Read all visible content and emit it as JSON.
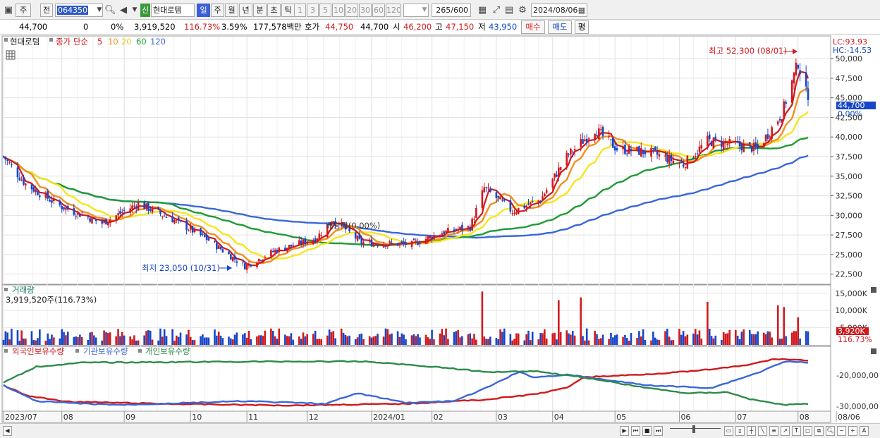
{
  "toolbar": {
    "type_label": "주",
    "prev_label": "전",
    "stock_code": "064350",
    "new_badge": "신",
    "stock_name": "현대로템",
    "periods": [
      "일",
      "주",
      "월",
      "년",
      "분",
      "초",
      "틱"
    ],
    "active_period": "일",
    "intervals": [
      "1",
      "3",
      "5",
      "10",
      "20",
      "30",
      "60",
      "120"
    ],
    "count_value": "265",
    "count_total": "/600",
    "date_value": "2024/08/06"
  },
  "info": {
    "price": "44,700",
    "change": "0",
    "change_pct": "0%",
    "volume": "3,919,520",
    "volume_ratio": "116.73%",
    "turnover": "3.59%",
    "amount": "177,578백만",
    "ask_label": "호가",
    "ask_value": "44,750",
    "bid_value": "44,700",
    "open_label": "시",
    "open_value": "46,200",
    "high_label": "고",
    "high_value": "47,150",
    "low_label": "저",
    "low_value": "43,950",
    "buy_label": "매수",
    "sell_label": "매도",
    "avg_label": "평"
  },
  "price_panel": {
    "stock_label": "현대로템",
    "ma_label": "종가 단순",
    "ma_periods": [
      "5",
      "10",
      "20",
      "60",
      "120"
    ],
    "lc_label": "LC:93.93",
    "hc_label": "HC:-14.53",
    "max_label": "최고 52,300 (08/01)",
    "min_label": "최저 23,050 (10/31)",
    "dividend_label": "배당락(0.00%)",
    "current_price_tag": "44,700",
    "current_pct_tag": "0.00%",
    "y_ticks": [
      "50,000",
      "47,500",
      "45,000",
      "42,500",
      "40,000",
      "37,500",
      "35,000",
      "32,500",
      "30,000",
      "27,500",
      "25,000",
      "22,500"
    ]
  },
  "volume_panel": {
    "title": "거래량",
    "value_label": "3,919,520주(116.73%)",
    "y_ticks": [
      "15,000K",
      "10,000K",
      "5,000K"
    ],
    "current_tag": "3,920K",
    "current_pct": "116.73%"
  },
  "holding_panel": {
    "legend": [
      "외국인보유수량",
      "기관보유수량",
      "개인보유수량"
    ],
    "y_ticks": [
      "-20,000,00",
      "-30,000,00"
    ]
  },
  "x_labels": [
    "2023/07",
    "08",
    "09",
    "10",
    "11",
    "12",
    "2024/01",
    "02",
    "03",
    "04",
    "05",
    "06",
    "07",
    "08",
    "08/06"
  ],
  "colors": {
    "ma5": "#d0191d",
    "ma10": "#f0901e",
    "ma20": "#f5e61e",
    "ma60": "#1f9a36",
    "ma120": "#3a67d8",
    "up": "#d0191d",
    "down": "#1746c9",
    "foreign": "#d0191d",
    "institution": "#3a67d8",
    "individual": "#2e8a4a"
  },
  "chart_data": {
    "type": "candlestick",
    "y_range": [
      21300,
      52800
    ],
    "annotations": {
      "max": 52300,
      "max_date": "08/01",
      "min": 23050,
      "min_date": "10/31",
      "last": 44700
    },
    "path_anchors": [
      {
        "date": "2023-07-03",
        "close": 37500
      },
      {
        "date": "2023-07-14",
        "close": 34000
      },
      {
        "date": "2023-07-31",
        "close": 31200
      },
      {
        "date": "2023-08-21",
        "close": 29000
      },
      {
        "date": "2023-09-08",
        "close": 31500
      },
      {
        "date": "2023-09-25",
        "close": 29500
      },
      {
        "date": "2023-10-12",
        "close": 27000
      },
      {
        "date": "2023-10-31",
        "close": 23500
      },
      {
        "date": "2023-11-15",
        "close": 25500
      },
      {
        "date": "2023-12-05",
        "close": 27000
      },
      {
        "date": "2023-12-14",
        "close": 29500
      },
      {
        "date": "2023-12-28",
        "close": 26500
      },
      {
        "date": "2024-01-22",
        "close": 26300
      },
      {
        "date": "2024-02-06",
        "close": 27800
      },
      {
        "date": "2024-02-20",
        "close": 28500
      },
      {
        "date": "2024-02-27",
        "close": 33500
      },
      {
        "date": "2024-03-12",
        "close": 30500
      },
      {
        "date": "2024-03-26",
        "close": 32000
      },
      {
        "date": "2024-04-08",
        "close": 37500
      },
      {
        "date": "2024-04-22",
        "close": 41000
      },
      {
        "date": "2024-05-03",
        "close": 38500
      },
      {
        "date": "2024-05-20",
        "close": 38000
      },
      {
        "date": "2024-06-05",
        "close": 36500
      },
      {
        "date": "2024-06-17",
        "close": 39500
      },
      {
        "date": "2024-07-01",
        "close": 39000
      },
      {
        "date": "2024-07-12",
        "close": 38500
      },
      {
        "date": "2024-07-24",
        "close": 43000
      },
      {
        "date": "2024-08-01",
        "close": 49500
      },
      {
        "date": "2024-08-06",
        "close": 44700
      }
    ],
    "volume_spikes": [
      {
        "date": "2024-02-26",
        "volume": 15500,
        "up": true
      },
      {
        "date": "2024-04-04",
        "volume": 13000,
        "up": true
      },
      {
        "date": "2024-04-15",
        "volume": 13800,
        "up": true
      },
      {
        "date": "2024-06-17",
        "volume": 12500,
        "up": true
      },
      {
        "date": "2024-07-22",
        "volume": 11500,
        "up": true
      },
      {
        "date": "2024-07-25",
        "volume": 11000,
        "up": true
      },
      {
        "date": "2024-08-01",
        "volume": 8000,
        "up": true
      }
    ],
    "volume_baseline_k": 3000,
    "volume_y_range": [
      0,
      17000
    ],
    "holding_series": [
      {
        "name": "외국인보유수량",
        "points": [
          [
            0,
            0.55
          ],
          [
            0.03,
            0.75
          ],
          [
            0.08,
            0.86
          ],
          [
            0.2,
            0.9
          ],
          [
            0.35,
            0.93
          ],
          [
            0.5,
            0.9
          ],
          [
            0.6,
            0.82
          ],
          [
            0.66,
            0.72
          ],
          [
            0.7,
            0.6
          ],
          [
            0.72,
            0.4
          ],
          [
            0.8,
            0.34
          ],
          [
            0.86,
            0.28
          ],
          [
            0.92,
            0.18
          ],
          [
            0.96,
            0.05
          ],
          [
            1,
            0.08
          ]
        ]
      },
      {
        "name": "기관보유수량",
        "points": [
          [
            0,
            0.55
          ],
          [
            0.04,
            0.85
          ],
          [
            0.1,
            0.9
          ],
          [
            0.15,
            0.92
          ],
          [
            0.3,
            0.85
          ],
          [
            0.4,
            0.9
          ],
          [
            0.44,
            0.7
          ],
          [
            0.5,
            0.88
          ],
          [
            0.56,
            0.85
          ],
          [
            0.6,
            0.6
          ],
          [
            0.64,
            0.3
          ],
          [
            0.66,
            0.4
          ],
          [
            0.7,
            0.35
          ],
          [
            0.8,
            0.55
          ],
          [
            0.88,
            0.6
          ],
          [
            0.94,
            0.3
          ],
          [
            0.97,
            0.1
          ],
          [
            1,
            0.12
          ]
        ]
      },
      {
        "name": "개인보유수량",
        "points": [
          [
            0,
            0.5
          ],
          [
            0.04,
            0.2
          ],
          [
            0.1,
            0.12
          ],
          [
            0.35,
            0.1
          ],
          [
            0.45,
            0.1
          ],
          [
            0.55,
            0.22
          ],
          [
            0.6,
            0.3
          ],
          [
            0.66,
            0.28
          ],
          [
            0.72,
            0.4
          ],
          [
            0.8,
            0.6
          ],
          [
            0.85,
            0.7
          ],
          [
            0.9,
            0.68
          ],
          [
            0.93,
            0.82
          ],
          [
            0.97,
            0.92
          ],
          [
            1,
            0.9
          ]
        ]
      }
    ]
  }
}
